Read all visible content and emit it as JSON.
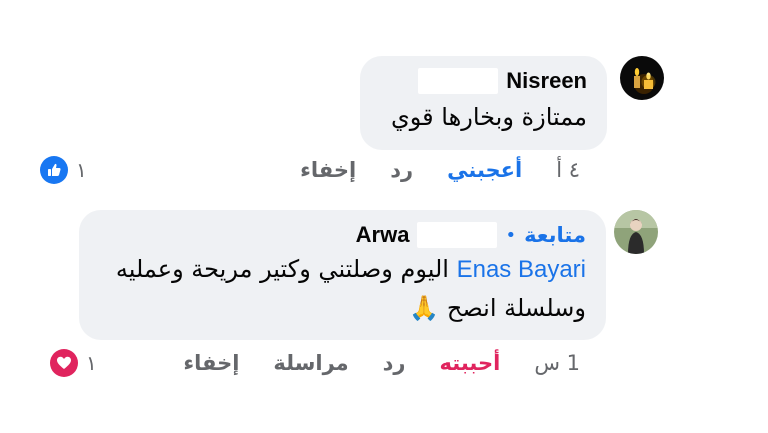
{
  "comments": [
    {
      "name": "Nisreen",
      "follow_label": "",
      "text_lines": [
        "ممتازة وبخارها قوي"
      ],
      "time": "٤ أ",
      "like_label": "أعجبني",
      "reply_label": "رد",
      "message_label": "",
      "hide_label": "إخفاء",
      "reaction_count": "١",
      "reaction_type": "like-icon",
      "reaction_color": "#1877f2"
    },
    {
      "name": "Arwa",
      "follow_label": "متابعة",
      "follow_dot": "•",
      "mention": "Enas Bayari",
      "text_line1": "اليوم وصلتني وكتير مريحة وعمليه",
      "text_line2": "وسلسلة انصح 🙏",
      "time": "1 س",
      "like_label": "أحببته",
      "reply_label": "رد",
      "message_label": "مراسلة",
      "hide_label": "إخفاء",
      "reaction_count": "١",
      "reaction_type": "heart-icon",
      "reaction_color": "#e0245e"
    }
  ],
  "colors": {
    "bubble": "#eff1f4",
    "link_blue": "#1a73e8",
    "muted": "#65676b",
    "love_red": "#e0245e"
  }
}
